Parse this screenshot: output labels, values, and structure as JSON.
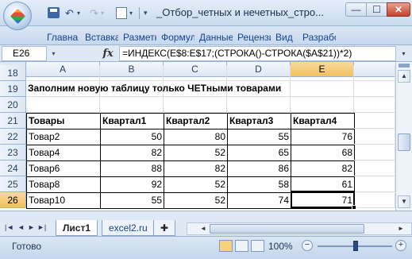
{
  "titlebar": {
    "doc_title": "_Отбор_четных и нечетных_стро...",
    "qa_undo_glyph": "↶",
    "qa_redo_glyph": "↷",
    "qa_dropdown_glyph": "▾",
    "qa_customize_glyph": "▾",
    "min_glyph": "—",
    "max_glyph": "☐",
    "close_glyph": "✕"
  },
  "ribbon_tabs": [
    "Главна",
    "Вставка",
    "Разметк",
    "Формул",
    "Данные",
    "Рецензи",
    "Вид",
    "Разработ"
  ],
  "formula_bar": {
    "name_box": "E26",
    "fx": "fx",
    "formula": "=ИНДЕКС(E$8:E$17;(СТРОКА()-СТРОКА($A$21))*2)",
    "dropdown_glyph": "▾",
    "expand_glyph": "▾"
  },
  "grid": {
    "columns": [
      "A",
      "B",
      "C",
      "D",
      "E"
    ],
    "active_column": "E",
    "active_row": "26",
    "rows": [
      {
        "num": "18",
        "cells": [
          "",
          "",
          "",
          "",
          ""
        ]
      },
      {
        "num": "19",
        "cells": [
          "Заполним новую таблицу только ЧЕТными товарами",
          "",
          "",
          "",
          ""
        ]
      },
      {
        "num": "20",
        "cells": [
          "",
          "",
          "",
          "",
          ""
        ]
      },
      {
        "num": "21",
        "cells": [
          "Товары",
          "Квартал1",
          "Квартал2",
          "Квартал3",
          "Квартал4"
        ]
      },
      {
        "num": "22",
        "cells": [
          "Товар2",
          "50",
          "80",
          "55",
          "76"
        ]
      },
      {
        "num": "23",
        "cells": [
          "Товар4",
          "82",
          "52",
          "65",
          "68"
        ]
      },
      {
        "num": "24",
        "cells": [
          "Товар6",
          "88",
          "82",
          "86",
          "82"
        ]
      },
      {
        "num": "25",
        "cells": [
          "Товар8",
          "92",
          "52",
          "58",
          "61"
        ]
      },
      {
        "num": "26",
        "cells": [
          "Товар10",
          "55",
          "52",
          "74",
          "71"
        ]
      }
    ]
  },
  "scroll": {
    "up": "▲",
    "down": "▼",
    "left": "◄",
    "right": "►"
  },
  "sheet_nav": {
    "first": "|◄",
    "prev": "◄",
    "next": "►",
    "last": "►|"
  },
  "sheets": {
    "active": "Лист1",
    "second": "excel2.ru",
    "new_glyph": "✚"
  },
  "status": {
    "text": "Готово",
    "zoom": "100%",
    "zoom_out": "−",
    "zoom_in": "+"
  },
  "colors": {
    "accent_header": "#f1c15f",
    "chrome": "#c5d6ea",
    "close": "#c4402a"
  }
}
